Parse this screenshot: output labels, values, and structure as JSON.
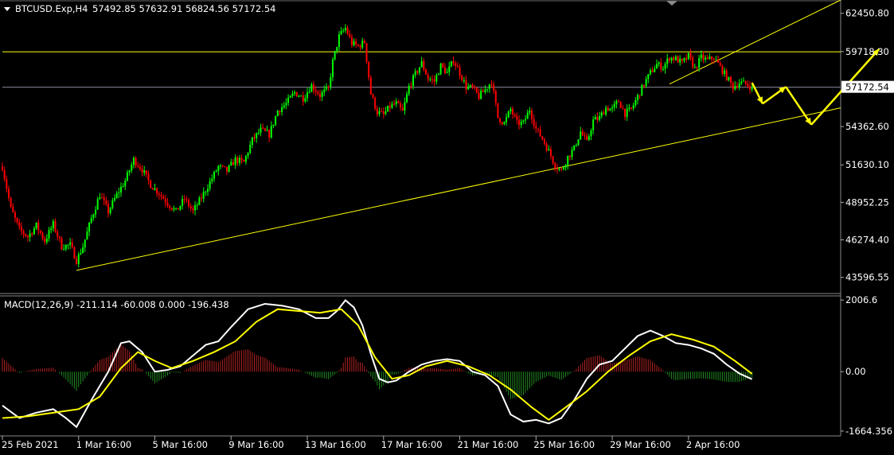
{
  "header": {
    "symbol": "BTCUSD.Exp,H4",
    "ohlc": "57492.85 57632.91 56824.56 57172.54"
  },
  "macd_header": "MACD(12,26,9) -211.114 -60.008 0.000 -196.438",
  "colors": {
    "background": "#000000",
    "bull": "#00ff00",
    "bear": "#ff0000",
    "trendline": "#ffff00",
    "macd_line": "#ffffff",
    "signal_line": "#ffff00",
    "hist_pos": "#b22222",
    "hist_neg": "#228b22",
    "price_tag_bg": "#ffffff"
  },
  "chart_data": [
    {
      "type": "candlestick",
      "ylim": [
        42500,
        63400
      ],
      "y_ticks": [
        "62450.80",
        "59718.30",
        "57172.54",
        "54362.60",
        "51630.10",
        "48952.25",
        "46274.40",
        "43596.55"
      ],
      "x_ticks": [
        "25 Feb 2021",
        "1 Mar 16:00",
        "5 Mar 16:00",
        "9 Mar 16:00",
        "13 Mar 16:00",
        "17 Mar 16:00",
        "21 Mar 16:00",
        "25 Mar 16:00",
        "29 Mar 16:00",
        "2 Apr 16:00"
      ],
      "current_price": "57172.54",
      "close_path": [
        [
          0,
          51500
        ],
        [
          4,
          48500
        ],
        [
          8,
          47000
        ],
        [
          12,
          46500
        ],
        [
          16,
          47300
        ],
        [
          20,
          46200
        ],
        [
          24,
          47400
        ],
        [
          28,
          45800
        ],
        [
          32,
          45900
        ],
        [
          35,
          44800
        ],
        [
          38,
          45800
        ],
        [
          42,
          47800
        ],
        [
          46,
          49500
        ],
        [
          50,
          48300
        ],
        [
          54,
          49500
        ],
        [
          58,
          50500
        ],
        [
          62,
          52000
        ],
        [
          66,
          51300
        ],
        [
          70,
          50200
        ],
        [
          74,
          49600
        ],
        [
          78,
          48900
        ],
        [
          82,
          48300
        ],
        [
          86,
          49200
        ],
        [
          90,
          48300
        ],
        [
          94,
          49300
        ],
        [
          98,
          50400
        ],
        [
          102,
          51500
        ],
        [
          106,
          51200
        ],
        [
          110,
          52000
        ],
        [
          114,
          51800
        ],
        [
          118,
          53400
        ],
        [
          122,
          54100
        ],
        [
          126,
          53800
        ],
        [
          130,
          55500
        ],
        [
          134,
          56000
        ],
        [
          138,
          56800
        ],
        [
          142,
          56400
        ],
        [
          146,
          57300
        ],
        [
          150,
          56600
        ],
        [
          154,
          57100
        ],
        [
          156,
          59000
        ],
        [
          159,
          60800
        ],
        [
          162,
          61400
        ],
        [
          165,
          60300
        ],
        [
          168,
          60100
        ],
        [
          171,
          60400
        ],
        [
          174,
          56700
        ],
        [
          177,
          55400
        ],
        [
          180,
          55200
        ],
        [
          183,
          55800
        ],
        [
          186,
          56000
        ],
        [
          189,
          55400
        ],
        [
          192,
          57200
        ],
        [
          195,
          58100
        ],
        [
          198,
          58900
        ],
        [
          201,
          57800
        ],
        [
          204,
          57600
        ],
        [
          207,
          58700
        ],
        [
          210,
          58200
        ],
        [
          213,
          59100
        ],
        [
          216,
          58200
        ],
        [
          219,
          57200
        ],
        [
          222,
          57100
        ],
        [
          225,
          56500
        ],
        [
          228,
          57000
        ],
        [
          231,
          57600
        ],
        [
          234,
          55000
        ],
        [
          237,
          54600
        ],
        [
          240,
          55600
        ],
        [
          243,
          54600
        ],
        [
          246,
          54600
        ],
        [
          249,
          55600
        ],
        [
          252,
          54200
        ],
        [
          255,
          53500
        ],
        [
          258,
          52600
        ],
        [
          261,
          51600
        ],
        [
          264,
          51200
        ],
        [
          267,
          52200
        ],
        [
          270,
          52800
        ],
        [
          273,
          54000
        ],
        [
          276,
          53200
        ],
        [
          279,
          54800
        ],
        [
          282,
          55000
        ],
        [
          285,
          55700
        ],
        [
          288,
          55600
        ],
        [
          291,
          56200
        ],
        [
          294,
          55300
        ],
        [
          297,
          55600
        ],
        [
          300,
          56500
        ],
        [
          303,
          57400
        ],
        [
          306,
          58200
        ],
        [
          309,
          58800
        ],
        [
          312,
          58600
        ],
        [
          315,
          59300
        ],
        [
          318,
          59200
        ],
        [
          321,
          58900
        ],
        [
          324,
          59400
        ],
        [
          327,
          58500
        ],
        [
          330,
          59300
        ],
        [
          333,
          59100
        ],
        [
          336,
          59300
        ],
        [
          339,
          58600
        ],
        [
          342,
          57900
        ],
        [
          345,
          57200
        ],
        [
          348,
          57500
        ],
        [
          351,
          57400
        ],
        [
          354,
          57172
        ]
      ],
      "trendlines": [
        {
          "from": [
            35,
            44100
          ],
          "to": [
            525,
            55700
          ]
        },
        {
          "from": [
            0,
            59700
          ],
          "to": [
            525,
            59700
          ]
        },
        {
          "from": [
            315,
            57400
          ],
          "to": [
            513,
            63400
          ]
        },
        {
          "from": [
            0,
            57172
          ],
          "to": [
            525,
            57172
          ]
        }
      ],
      "forecast_arrows": [
        [
          [
            354,
            57500
          ],
          [
            359,
            56000
          ]
        ],
        [
          [
            359,
            56000
          ],
          [
            370,
            57200
          ]
        ],
        [
          [
            370,
            57200
          ],
          [
            382,
            54500
          ]
        ],
        [
          [
            382,
            54500
          ],
          [
            414,
            59900
          ]
        ]
      ]
    },
    {
      "type": "macd",
      "ylim": [
        -1800,
        2100
      ],
      "y_ticks": [
        "2006.6",
        "0.00",
        "-1664.356"
      ],
      "macd_path": [
        [
          0,
          -950
        ],
        [
          8,
          -1300
        ],
        [
          16,
          -1150
        ],
        [
          24,
          -1050
        ],
        [
          30,
          -1300
        ],
        [
          35,
          -1550
        ],
        [
          42,
          -800
        ],
        [
          50,
          0
        ],
        [
          56,
          800
        ],
        [
          60,
          850
        ],
        [
          66,
          550
        ],
        [
          72,
          0
        ],
        [
          78,
          50
        ],
        [
          84,
          150
        ],
        [
          90,
          450
        ],
        [
          96,
          750
        ],
        [
          102,
          850
        ],
        [
          108,
          1250
        ],
        [
          116,
          1750
        ],
        [
          124,
          1900
        ],
        [
          132,
          1850
        ],
        [
          140,
          1750
        ],
        [
          148,
          1500
        ],
        [
          154,
          1500
        ],
        [
          158,
          1700
        ],
        [
          162,
          2000
        ],
        [
          166,
          1800
        ],
        [
          170,
          1300
        ],
        [
          174,
          500
        ],
        [
          178,
          -200
        ],
        [
          182,
          -300
        ],
        [
          186,
          -250
        ],
        [
          192,
          0
        ],
        [
          198,
          200
        ],
        [
          204,
          300
        ],
        [
          210,
          350
        ],
        [
          216,
          300
        ],
        [
          222,
          0
        ],
        [
          228,
          -100
        ],
        [
          234,
          -400
        ],
        [
          240,
          -1200
        ],
        [
          246,
          -1400
        ],
        [
          252,
          -1350
        ],
        [
          258,
          -1450
        ],
        [
          264,
          -1300
        ],
        [
          270,
          -800
        ],
        [
          276,
          -200
        ],
        [
          282,
          200
        ],
        [
          288,
          300
        ],
        [
          294,
          650
        ],
        [
          300,
          1000
        ],
        [
          306,
          1150
        ],
        [
          312,
          1000
        ],
        [
          318,
          800
        ],
        [
          324,
          750
        ],
        [
          330,
          650
        ],
        [
          336,
          500
        ],
        [
          342,
          200
        ],
        [
          348,
          -50
        ],
        [
          354,
          -211
        ]
      ],
      "signal_path": [
        [
          0,
          -1300
        ],
        [
          12,
          -1250
        ],
        [
          24,
          -1150
        ],
        [
          36,
          -1050
        ],
        [
          46,
          -700
        ],
        [
          56,
          100
        ],
        [
          64,
          550
        ],
        [
          72,
          300
        ],
        [
          80,
          100
        ],
        [
          90,
          300
        ],
        [
          100,
          550
        ],
        [
          110,
          850
        ],
        [
          120,
          1400
        ],
        [
          130,
          1750
        ],
        [
          140,
          1700
        ],
        [
          150,
          1650
        ],
        [
          160,
          1750
        ],
        [
          168,
          1300
        ],
        [
          176,
          400
        ],
        [
          184,
          -200
        ],
        [
          192,
          -100
        ],
        [
          200,
          150
        ],
        [
          210,
          300
        ],
        [
          220,
          150
        ],
        [
          230,
          -100
        ],
        [
          240,
          -500
        ],
        [
          250,
          -1000
        ],
        [
          258,
          -1350
        ],
        [
          266,
          -1000
        ],
        [
          276,
          -550
        ],
        [
          286,
          0
        ],
        [
          296,
          450
        ],
        [
          306,
          850
        ],
        [
          316,
          1050
        ],
        [
          326,
          900
        ],
        [
          336,
          700
        ],
        [
          346,
          300
        ],
        [
          354,
          -60
        ]
      ]
    }
  ]
}
